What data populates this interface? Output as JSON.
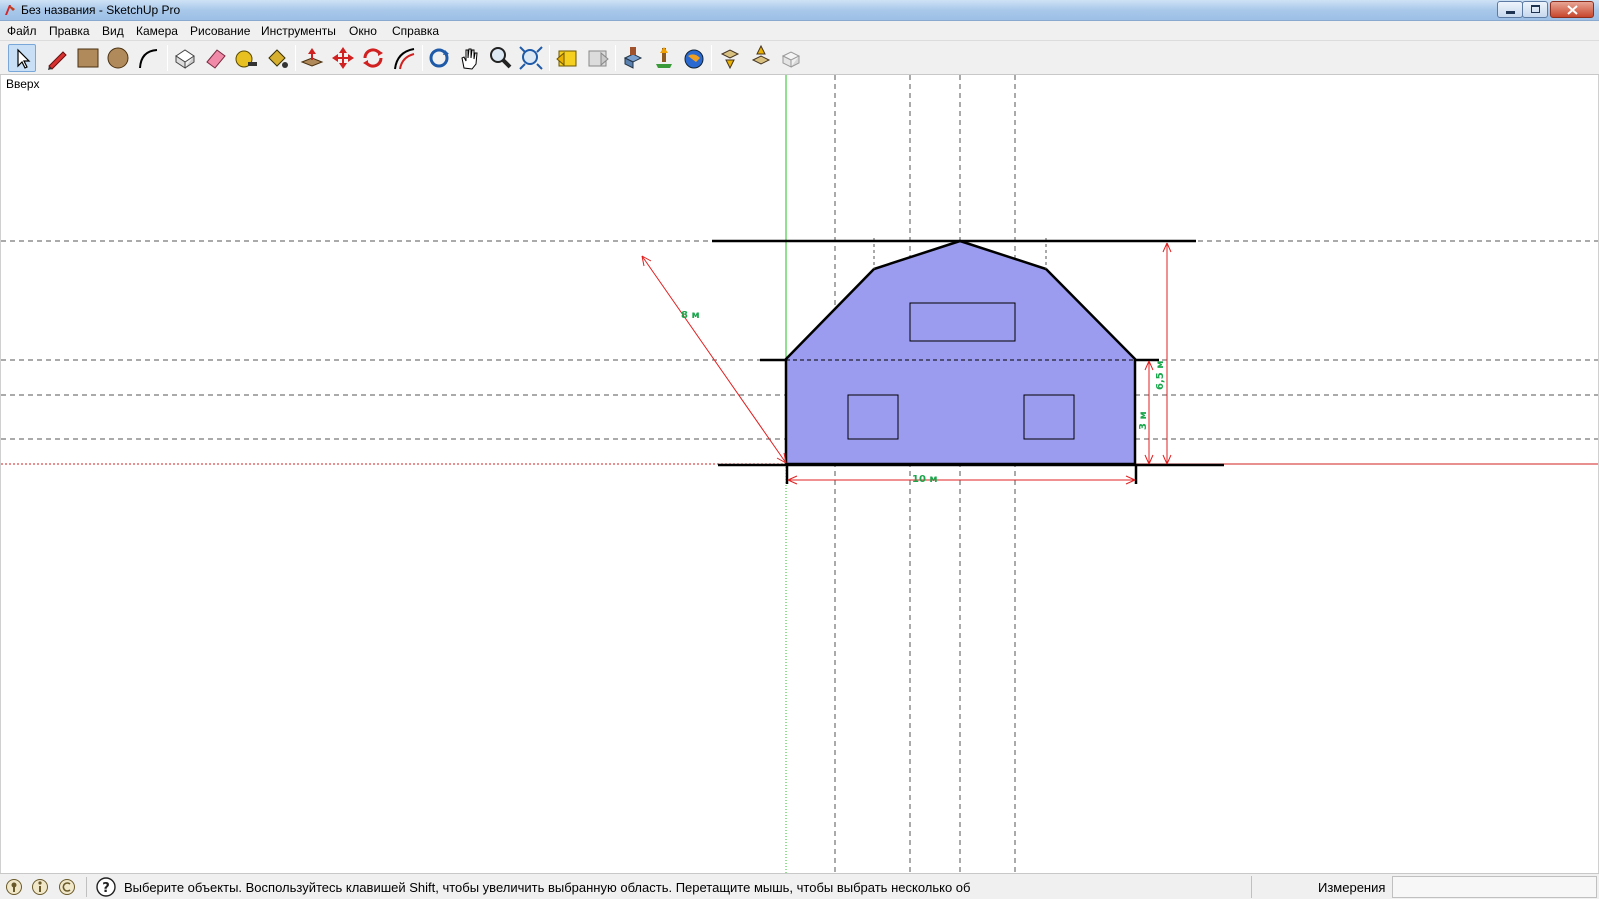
{
  "window": {
    "title": "Без названия - SketchUp Pro"
  },
  "menu": {
    "items": [
      {
        "label": "Файл"
      },
      {
        "label": "Правка"
      },
      {
        "label": "Вид"
      },
      {
        "label": "Камера"
      },
      {
        "label": "Рисование"
      },
      {
        "label": "Инструменты"
      },
      {
        "label": "Окно"
      },
      {
        "label": "Справка"
      }
    ]
  },
  "toolbar": {
    "tools": [
      {
        "icon": "select-arrow-icon",
        "active": true
      },
      {
        "icon": "pencil-line-icon"
      },
      {
        "icon": "rectangle-icon"
      },
      {
        "icon": "circle-icon"
      },
      {
        "icon": "arc-icon"
      },
      {
        "icon": "make-component-icon"
      },
      {
        "icon": "eraser-icon"
      },
      {
        "icon": "tape-measure-icon"
      },
      {
        "icon": "paint-bucket-icon"
      },
      {
        "icon": "push-pull-icon"
      },
      {
        "icon": "move-icon"
      },
      {
        "icon": "rotate-icon"
      },
      {
        "icon": "offset-icon"
      },
      {
        "icon": "orbit-icon"
      },
      {
        "icon": "pan-hand-icon"
      },
      {
        "icon": "zoom-icon"
      },
      {
        "icon": "zoom-extents-icon"
      },
      {
        "icon": "previous-view-icon"
      },
      {
        "icon": "next-view-icon"
      },
      {
        "icon": "get-models-icon"
      },
      {
        "icon": "share-model-icon"
      },
      {
        "icon": "google-earth-icon"
      },
      {
        "icon": "get-components-icon"
      },
      {
        "icon": "share-component-icon"
      },
      {
        "icon": "extension-icon"
      }
    ]
  },
  "viewport": {
    "view_name": "Вверх",
    "dimensions": {
      "diagonal": "8 м",
      "height_total": "6,5 м",
      "height_wall": "3 м",
      "width": "10 м"
    },
    "colors": {
      "house_fill": "#9b9cf0",
      "dimension": "#e02020",
      "dimension_text": "#1aa64b",
      "green_axis": "#22c022",
      "red_axis": "#d02020",
      "guide": "#555555",
      "edge": "#000000"
    }
  },
  "status": {
    "message": "Выберите объекты. Воспользуйтесь клавишей Shift, чтобы увеличить выбранную область. Перетащите мышь, чтобы выбрать несколько об",
    "measurements_label": "Измерения",
    "measurements_value": ""
  }
}
